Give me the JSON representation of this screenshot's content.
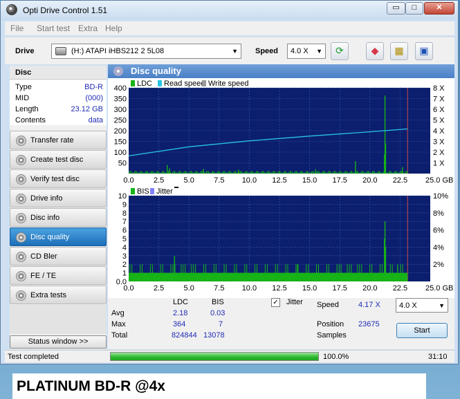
{
  "window": {
    "title": "Opti Drive Control 1.51",
    "minimize": "▭",
    "maximize": "□",
    "close": "✕"
  },
  "menu": [
    "File",
    "Start test",
    "Extra",
    "Help"
  ],
  "toolbar": {
    "drive_label": "Drive",
    "drive_value": "(H:)  ATAPI iHBS212   2 5L08",
    "speed_label": "Speed",
    "speed_value": "4.0 X",
    "icons": [
      "refresh-icon",
      "eraser-icon",
      "chip-icon",
      "save-icon"
    ]
  },
  "sidebar": {
    "header": "Disc",
    "info": [
      {
        "key": "Type",
        "value": "BD-R"
      },
      {
        "key": "MID",
        "value": "(000)"
      },
      {
        "key": "Length",
        "value": "23.12 GB"
      },
      {
        "key": "Contents",
        "value": "data"
      }
    ],
    "nav": [
      "Transfer rate",
      "Create test disc",
      "Verify test disc",
      "Drive info",
      "Disc info",
      "Disc quality",
      "CD Bler",
      "FE / TE",
      "Extra tests"
    ],
    "active": "Disc quality",
    "status_window": "Status window >>"
  },
  "panel": {
    "title": "Disc quality"
  },
  "chart_data": [
    {
      "type": "line",
      "legend": [
        "LDC",
        "Read speed",
        "Write speed"
      ],
      "colors": {
        "ldc": "#17b317",
        "read": "#29c3e6",
        "write": "#9a9a9a",
        "marker": "#d24747",
        "bg": "#0b1f6e"
      },
      "x_ticks": [
        "0.0",
        "2.5",
        "5.0",
        "7.5",
        "10.0",
        "12.5",
        "15.0",
        "17.5",
        "20.0",
        "22.5",
        "25.0 GB"
      ],
      "y_left_ticks": [
        "400",
        "350",
        "300",
        "250",
        "200",
        "150",
        "100",
        "50"
      ],
      "y_right_ticks": [
        "8 X",
        "7 X",
        "6 X",
        "5 X",
        "4 X",
        "3 X",
        "2 X",
        "1 X"
      ],
      "ylim": [
        0,
        400
      ],
      "xlim": [
        0,
        25
      ],
      "y2lim": [
        0,
        8
      ],
      "grid": true,
      "disc_end_gb": 23.12,
      "read_speed": {
        "x": [
          0,
          5,
          10,
          15,
          20,
          23.12
        ],
        "y": [
          1.65,
          2.5,
          3.05,
          3.5,
          3.9,
          4.17
        ]
      },
      "ldc_baseline": 10,
      "ldc_spikes": [
        {
          "x": 3.2,
          "y": 40
        },
        {
          "x": 3.4,
          "y": 24
        },
        {
          "x": 6.2,
          "y": 22
        },
        {
          "x": 9.1,
          "y": 18
        },
        {
          "x": 15.5,
          "y": 20
        },
        {
          "x": 18.8,
          "y": 58
        },
        {
          "x": 21.2,
          "y": 90
        },
        {
          "x": 21.25,
          "y": 364
        },
        {
          "x": 21.3,
          "y": 140
        },
        {
          "x": 22.7,
          "y": 30
        }
      ]
    },
    {
      "type": "bar",
      "legend": [
        "BIS",
        "Jitter"
      ],
      "colors": {
        "bis": "#17b317",
        "jitter": "#8080ff",
        "marker": "#d24747",
        "bg": "#0b1f6e"
      },
      "x_ticks": [
        "0.0",
        "2.5",
        "5.0",
        "7.5",
        "10.0",
        "12.5",
        "15.0",
        "17.5",
        "20.0",
        "22.5",
        "25.0 GB"
      ],
      "y_left_ticks": [
        "10",
        "9",
        "8",
        "7",
        "6",
        "5",
        "4",
        "3",
        "2",
        "1"
      ],
      "y_right_ticks": [
        "10%",
        "8%",
        "6%",
        "4%",
        "2%"
      ],
      "ylim": [
        0,
        10
      ],
      "xlim": [
        0,
        25
      ],
      "grid": true,
      "bis_baseline": 1,
      "bis_spikes": [
        {
          "x": 3.8,
          "y": 3
        },
        {
          "x": 14.0,
          "y": 2
        },
        {
          "x": 21.2,
          "y": 5
        },
        {
          "x": 21.25,
          "y": 7
        },
        {
          "x": 21.3,
          "y": 4
        },
        {
          "x": 22.3,
          "y": 2
        }
      ]
    }
  ],
  "stats": {
    "col_ldc": "LDC",
    "col_bis": "BIS",
    "rows": [
      {
        "label": "Avg",
        "ldc": "2.18",
        "bis": "0.03"
      },
      {
        "label": "Max",
        "ldc": "364",
        "bis": "7"
      },
      {
        "label": "Total",
        "ldc": "824844",
        "bis": "13078"
      }
    ],
    "jitter_label": "Jitter",
    "jitter_checked": "✓",
    "speed_label": "Speed",
    "speed_value": "4.17 X",
    "position_label": "Position",
    "position_value": "23675",
    "samples_label": "Samples",
    "speed_select": "4.0 X",
    "start_button": "Start"
  },
  "status": {
    "text": "Test completed",
    "percent": "100.0%",
    "progress": 1.0,
    "time": "31:10"
  },
  "caption": "PLATINUM BD-R @4x"
}
